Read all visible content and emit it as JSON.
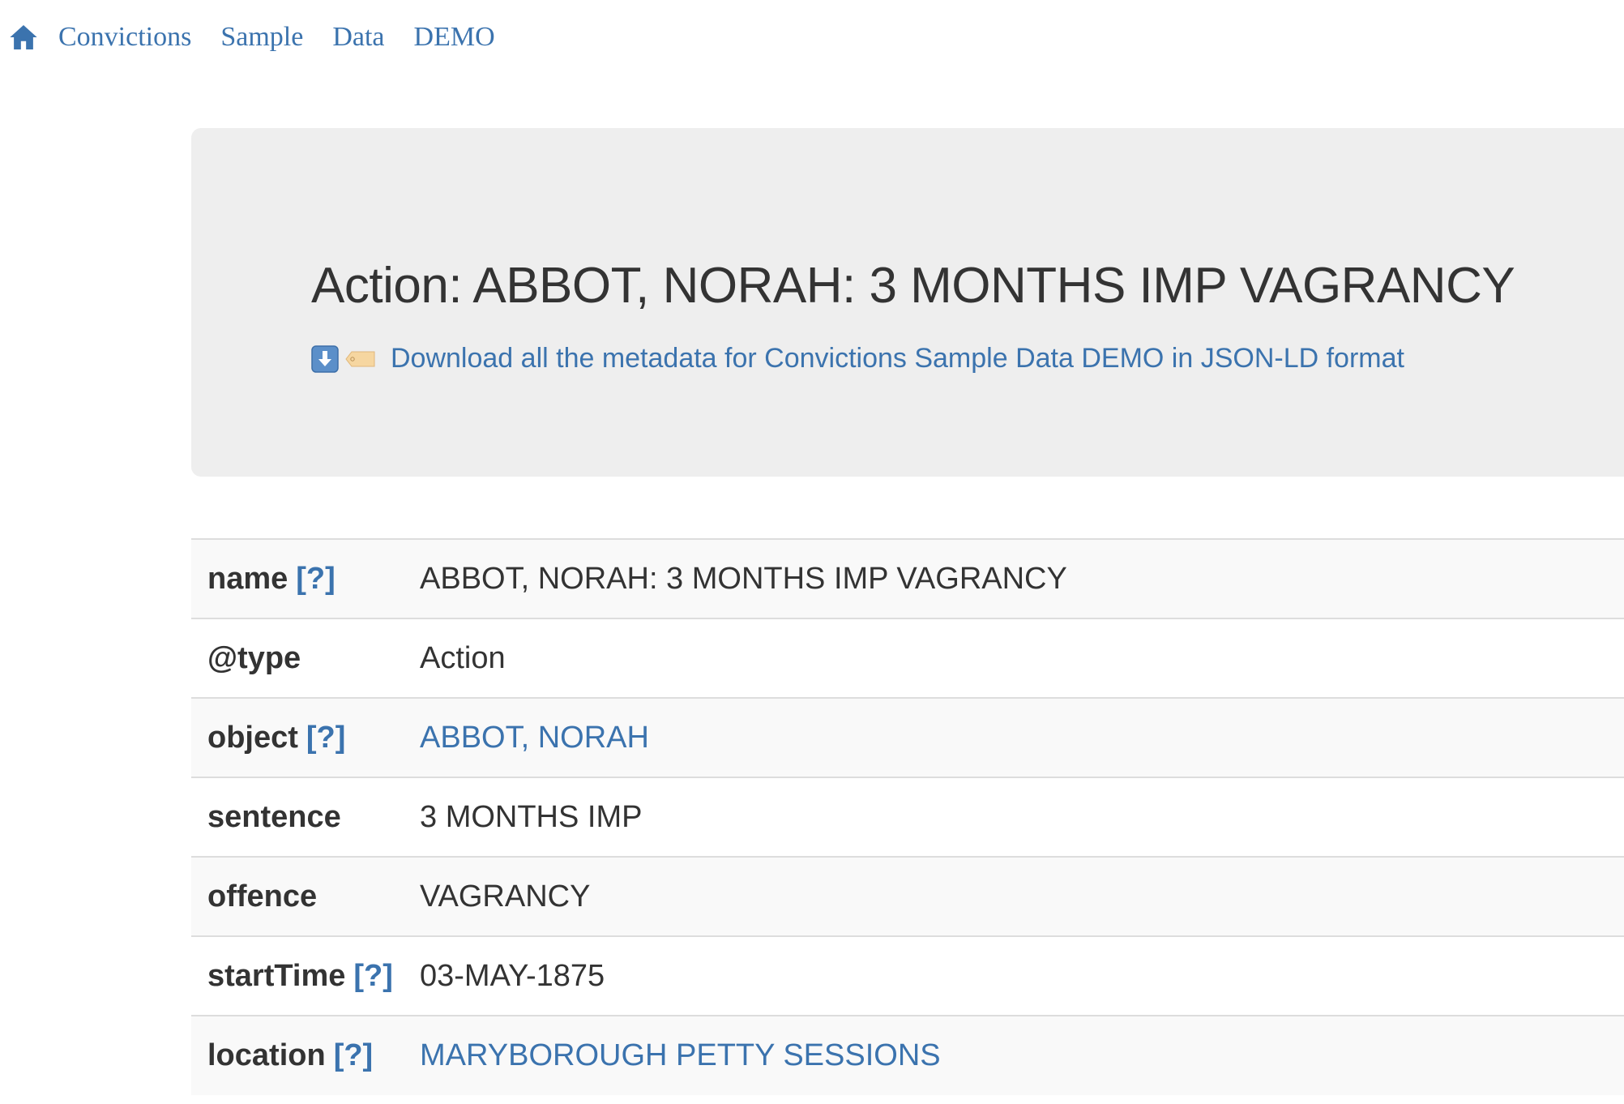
{
  "nav": {
    "home_icon": "home-icon",
    "items": [
      "Convictions",
      "Sample",
      "Data",
      "DEMO"
    ]
  },
  "header": {
    "title": "Action: ABBOT, NORAH: 3 MONTHS IMP VAGRANCY",
    "download_icons": [
      "download-arrow-icon",
      "tag-icon"
    ],
    "download_link": "Download all the metadata for Convictions Sample Data DEMO in JSON-LD format"
  },
  "properties": [
    {
      "key": "name",
      "help": "[?]",
      "value": "ABBOT, NORAH: 3 MONTHS IMP VAGRANCY",
      "value_is_link": false
    },
    {
      "key": "@type",
      "help": "",
      "value": "Action",
      "value_is_link": false
    },
    {
      "key": "object",
      "help": "[?]",
      "value": "ABBOT, NORAH",
      "value_is_link": true
    },
    {
      "key": "sentence",
      "help": "",
      "value": "3 MONTHS IMP",
      "value_is_link": false
    },
    {
      "key": "offence",
      "help": "",
      "value": "VAGRANCY",
      "value_is_link": false
    },
    {
      "key": "startTime",
      "help": "[?]",
      "value": "03-MAY-1875",
      "value_is_link": false
    },
    {
      "key": "location",
      "help": "[?]",
      "value": "MARYBOROUGH PETTY SESSIONS",
      "value_is_link": true
    }
  ],
  "colors": {
    "link": "#3b73ae",
    "text": "#333333",
    "jumbotron_bg": "#eeeeee",
    "row_stripe": "#f9f9f9",
    "row_border": "#dddddd"
  }
}
